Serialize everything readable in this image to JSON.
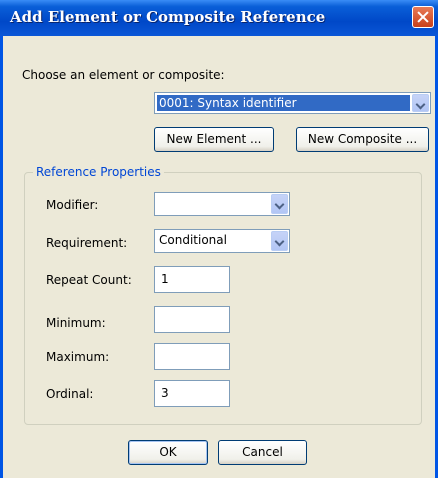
{
  "window": {
    "title": "Add Element or Composite Reference"
  },
  "chooser": {
    "label": "Choose an element or composite:",
    "selected": "0001: Syntax identifier",
    "new_element_label": "New Element ...",
    "new_composite_label": "New Composite ..."
  },
  "reference_properties": {
    "legend": "Reference Properties",
    "modifier": {
      "label": "Modifier:",
      "value": ""
    },
    "requirement": {
      "label": "Requirement:",
      "value": "Conditional"
    },
    "repeat_count": {
      "label": "Repeat Count:",
      "value": "1"
    },
    "minimum": {
      "label": "Minimum:",
      "value": ""
    },
    "maximum": {
      "label": "Maximum:",
      "value": ""
    },
    "ordinal": {
      "label": "Ordinal:",
      "value": "3"
    }
  },
  "buttons": {
    "ok": "OK",
    "cancel": "Cancel"
  },
  "icons": {
    "close": "close-icon",
    "dropdown": "chevron-down-icon"
  },
  "colors": {
    "titlebar": "#0a56d6",
    "dialog_bg": "#ece9d8",
    "legend_text": "#0046d5",
    "selection": "#316ac5"
  }
}
